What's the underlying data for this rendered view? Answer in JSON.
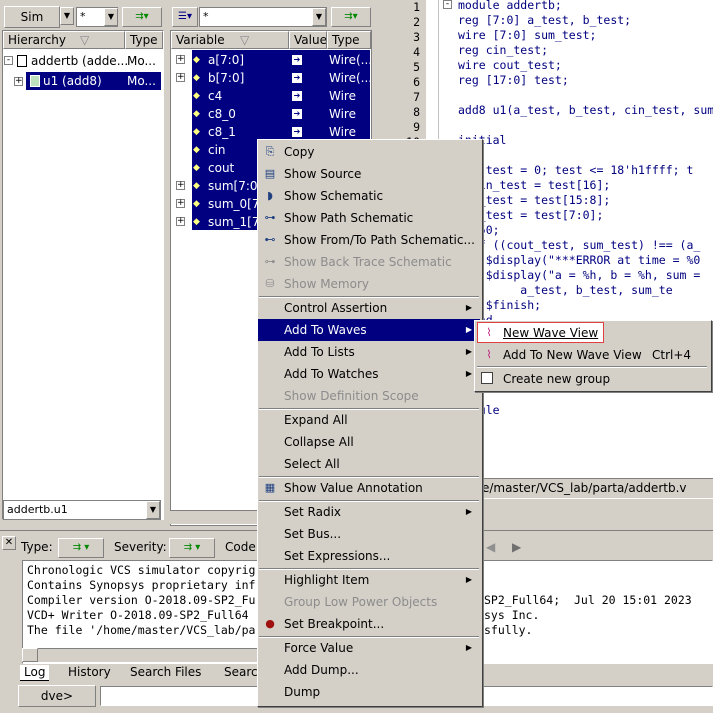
{
  "sim_toolbar": {
    "sim_label": "Sim",
    "filter_value": "*"
  },
  "hierarchy": {
    "col_hierarchy": "Hierarchy",
    "col_type": "Type",
    "rows": [
      {
        "name": "addertb (adde...",
        "type": "Mo..."
      },
      {
        "name": "u1 (add8)",
        "type": "Mo..."
      }
    ],
    "scope_value": "addertb.u1"
  },
  "variables": {
    "filter_value": "*",
    "col_variable": "Variable",
    "col_value": "Value",
    "col_type": "Type",
    "rows": [
      {
        "name": "a[7:0]",
        "type": "Wire(..."
      },
      {
        "name": "b[7:0]",
        "type": "Wire(..."
      },
      {
        "name": "c4",
        "type": "Wire"
      },
      {
        "name": "c8_0",
        "type": "Wire"
      },
      {
        "name": "c8_1",
        "type": "Wire"
      },
      {
        "name": "cin",
        "type": ""
      },
      {
        "name": "cout",
        "type": ""
      },
      {
        "name": "sum[7:0]",
        "type": ""
      },
      {
        "name": "sum_0[7...",
        "type": ""
      },
      {
        "name": "sum_1[7...",
        "type": ""
      }
    ]
  },
  "source": {
    "line_numbers": [
      "1",
      "2",
      "3",
      "4",
      "5",
      "6",
      "7",
      "8",
      "9",
      "10"
    ],
    "lines": [
      "module addertb;",
      "reg [7:0] a_test, b_test;",
      "wire [7:0] sum_test;",
      "reg cin_test;",
      "wire cout_test;",
      "reg [17:0] test;",
      "",
      "add8 u1(a_test, b_test, cin_test, sum",
      "",
      "initial",
      "in",
      "or (test = 0; test <= 18'h1ffff; t",
      "  cin_test = test[16];",
      "  a_test = test[15:8];",
      "  b_test = test[7:0];",
      "  #50;",
      "  if ((cout_test, sum_test) !== (a_",
      "    $display(\"***ERROR at time = %0",
      "    $display(\"a = %h, b = %h, sum =",
      "         a_test, b_test, sum_te",
      "    $finish;",
      "  end",
      "",
      "",
      "",
      "",
      "",
      "nodule"
    ],
    "file_path": "e/master/VCS_lab/parta/addertb.v"
  },
  "console": {
    "type_label": "Type:",
    "severity_label": "Severity:",
    "code_label": "Code:",
    "lines": [
      "Chronologic VCS simulator copyrig",
      "Contains Synopsys proprietary inf",
      "Compiler version O-2018.09-SP2_Fu",
      "VCD+ Writer O-2018.09-SP2_Full64",
      "The file '/home/master/VCS_lab/pa"
    ],
    "right_lines": [
      "SP2_Full64;  Jul 20 15:01 2023",
      "sys Inc.",
      "sfully."
    ],
    "tabs": [
      "Log",
      "History",
      "Search Files",
      "Searc"
    ],
    "prompt": "dve>"
  },
  "context_menu": {
    "items": [
      {
        "label": "Copy",
        "icon": "copy-icon",
        "enabled": true,
        "submenu": false
      },
      {
        "label": "Show Source",
        "icon": "source-icon",
        "enabled": true,
        "submenu": false
      },
      {
        "label": "Show Schematic",
        "icon": "schematic-icon",
        "enabled": true,
        "submenu": false
      },
      {
        "label": "Show Path Schematic",
        "icon": "path-schematic-icon",
        "enabled": true,
        "submenu": false
      },
      {
        "label": "Show From/To Path Schematic...",
        "icon": "from-to-path-icon",
        "enabled": true,
        "submenu": false
      },
      {
        "label": "Show Back Trace Schematic",
        "icon": "back-trace-icon",
        "enabled": false,
        "submenu": false
      },
      {
        "label": "Show Memory",
        "icon": "memory-icon",
        "enabled": false,
        "submenu": false
      },
      {
        "label": "Control Assertion",
        "icon": "",
        "enabled": true,
        "submenu": true
      },
      {
        "label": "Add To Waves",
        "icon": "",
        "enabled": true,
        "submenu": true,
        "highlighted": true
      },
      {
        "label": "Add To Lists",
        "icon": "",
        "enabled": true,
        "submenu": true
      },
      {
        "label": "Add To Watches",
        "icon": "",
        "enabled": true,
        "submenu": true
      },
      {
        "label": "Show Definition Scope",
        "icon": "",
        "enabled": false,
        "submenu": false
      },
      {
        "label": "Expand All",
        "icon": "",
        "enabled": true,
        "submenu": false
      },
      {
        "label": "Collapse All",
        "icon": "",
        "enabled": true,
        "submenu": false
      },
      {
        "label": "Select All",
        "icon": "",
        "enabled": true,
        "submenu": false
      },
      {
        "label": "Show Value Annotation",
        "icon": "value-annotation-icon",
        "enabled": true,
        "submenu": false
      },
      {
        "label": "Set Radix",
        "icon": "",
        "enabled": true,
        "submenu": true
      },
      {
        "label": "Set Bus...",
        "icon": "",
        "enabled": true,
        "submenu": false
      },
      {
        "label": "Set Expressions...",
        "icon": "",
        "enabled": true,
        "submenu": false
      },
      {
        "label": "Highlight Item",
        "icon": "",
        "enabled": true,
        "submenu": true
      },
      {
        "label": "Group Low Power Objects",
        "icon": "",
        "enabled": false,
        "submenu": false
      },
      {
        "label": "Set Breakpoint...",
        "icon": "breakpoint-icon",
        "enabled": true,
        "submenu": false
      },
      {
        "label": "Force Value",
        "icon": "",
        "enabled": true,
        "submenu": true
      },
      {
        "label": "Add Dump...",
        "icon": "",
        "enabled": true,
        "submenu": false
      },
      {
        "label": "Dump",
        "icon": "",
        "enabled": true,
        "submenu": false
      }
    ]
  },
  "submenu": {
    "items": [
      {
        "label": "New Wave View",
        "shortcut": "",
        "icon": "wave-view-icon"
      },
      {
        "label": "Add To New Wave View",
        "shortcut": "Ctrl+4",
        "icon": "add-wave-view-icon"
      },
      {
        "label": "Create new group",
        "shortcut": "",
        "icon": "checkbox-icon"
      }
    ]
  },
  "colors": {
    "selection": "#000080",
    "code_text": "#000080",
    "highlight_box": "#e04040"
  }
}
